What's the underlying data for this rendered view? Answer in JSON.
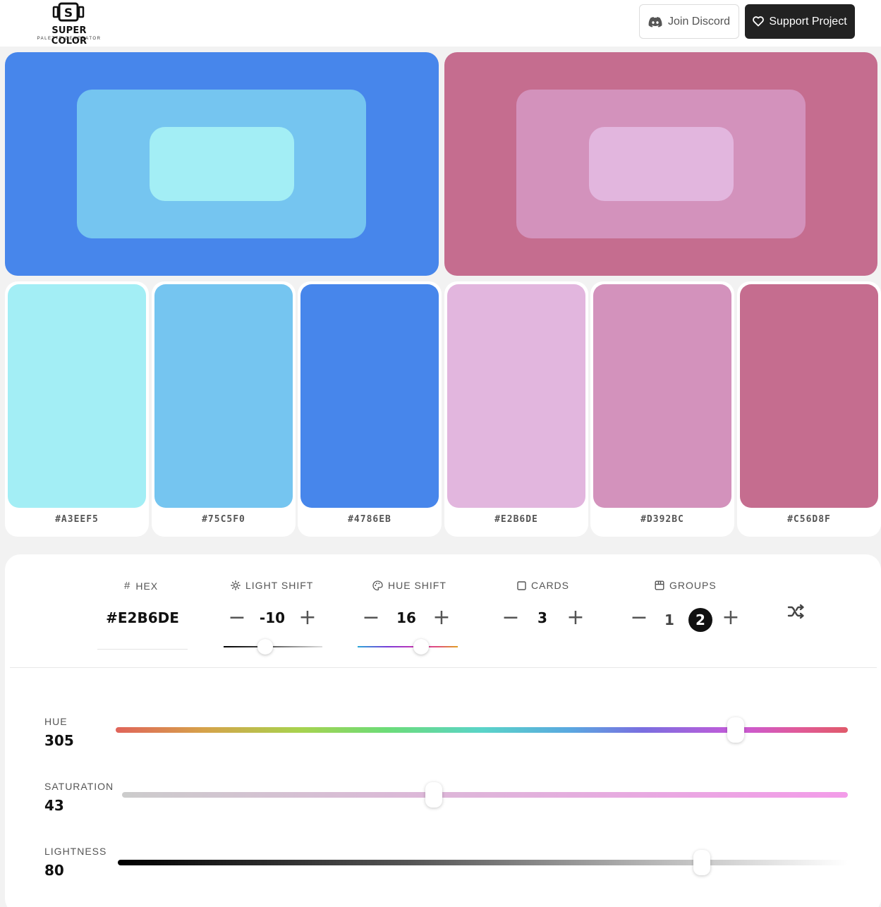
{
  "header": {
    "logo_title": "SUPER COLOR",
    "logo_subtitle": "PALETTE GENERATOR",
    "logo_letter": "S",
    "discord_label": "Join Discord",
    "support_label": "Support Project",
    "discord_icon": "discord-icon",
    "support_icon": "heart-icon"
  },
  "groups": [
    {
      "outer": "#4786EB",
      "mid": "#75C5F0",
      "inner": "#A3EEF5"
    },
    {
      "outer": "#C56D8F",
      "mid": "#D392BC",
      "inner": "#E2B6DE"
    }
  ],
  "swatches": [
    "#A3EEF5",
    "#75C5F0",
    "#4786EB",
    "#E2B6DE",
    "#D392BC",
    "#C56D8F"
  ],
  "controls": {
    "hex": {
      "label": "HEX",
      "value": "#E2B6DE",
      "icon": "hash-icon"
    },
    "light_shift": {
      "label": "LIGHT SHIFT",
      "value": "-10",
      "icon": "sun-icon"
    },
    "hue_shift": {
      "label": "HUE SHIFT",
      "value": "16",
      "icon": "palette-icon"
    },
    "cards": {
      "label": "CARDS",
      "value": "3",
      "icon": "square-icon"
    },
    "groups": {
      "label": "GROUPS",
      "options": [
        "1",
        "2"
      ],
      "selected": "2",
      "icon": "box-icon"
    },
    "minus": "−",
    "plus": "+",
    "shuffle_icon": "shuffle-icon"
  },
  "sliders": {
    "hue": {
      "label": "HUE",
      "value": "305",
      "fraction": 0.847
    },
    "saturation": {
      "label": "SATURATION",
      "value": "43",
      "fraction": 0.43
    },
    "lightness": {
      "label": "LIGHTNESS",
      "value": "80",
      "fraction": 0.8
    }
  }
}
